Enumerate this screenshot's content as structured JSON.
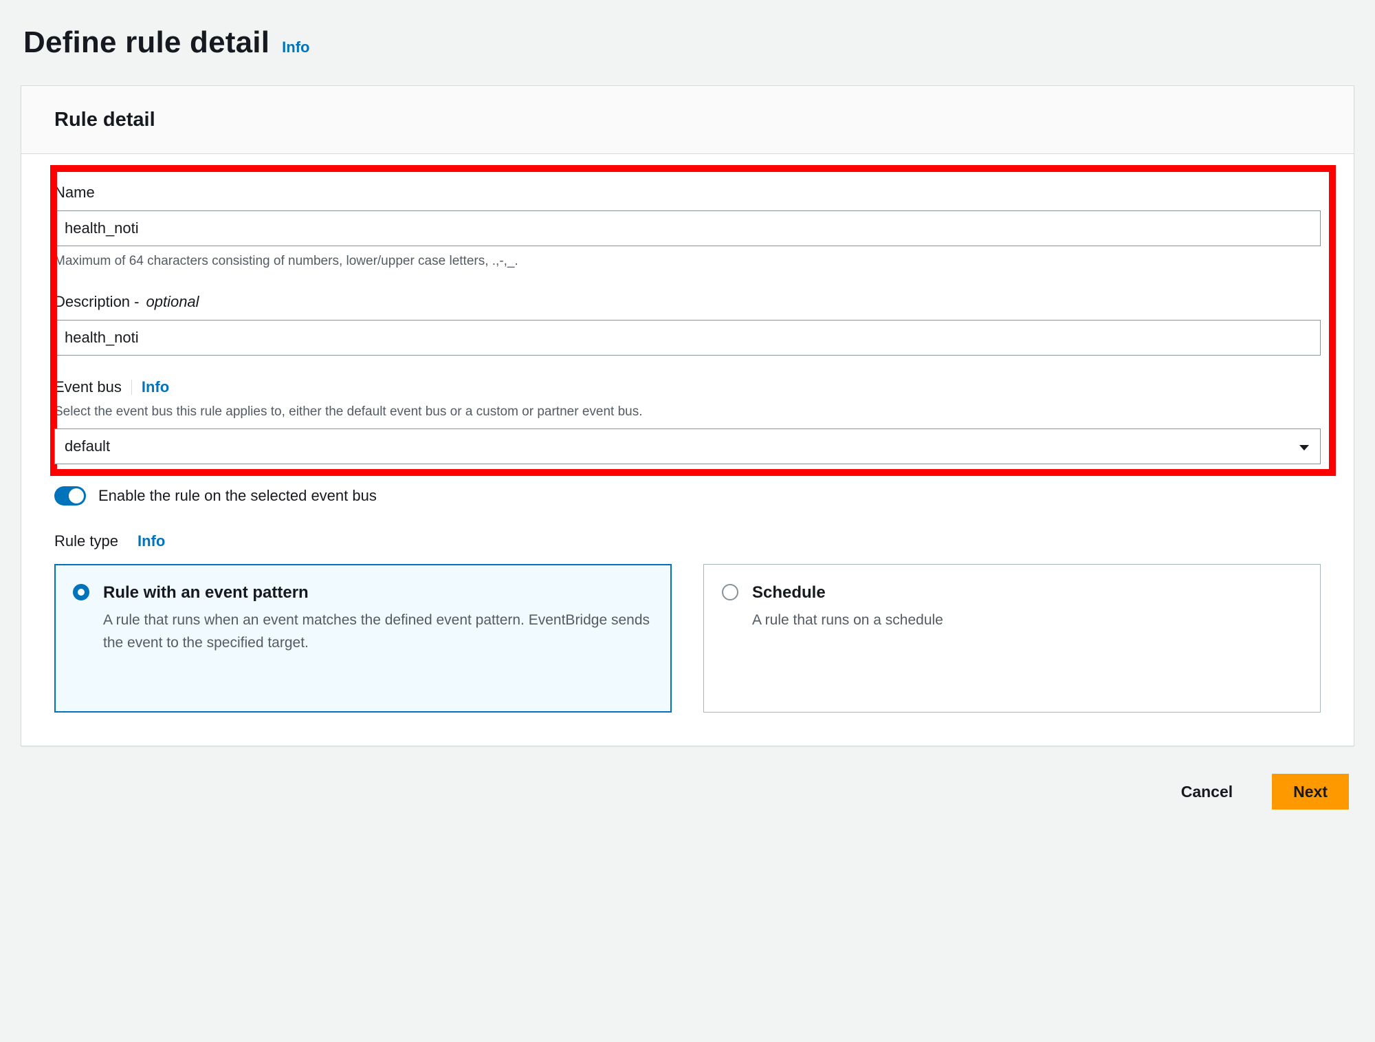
{
  "page": {
    "title": "Define rule detail",
    "info_label": "Info"
  },
  "card": {
    "header": "Rule detail"
  },
  "fields": {
    "name": {
      "label": "Name",
      "value": "health_noti",
      "hint": "Maximum of 64 characters consisting of numbers, lower/upper case letters, .,-,_."
    },
    "description": {
      "label": "Description - ",
      "optional": "optional",
      "value": "health_noti"
    },
    "event_bus": {
      "label": "Event bus",
      "info_label": "Info",
      "hint": "Select the event bus this rule applies to, either the default event bus or a custom or partner event bus.",
      "selected": "default"
    },
    "enable_toggle": {
      "on": true,
      "label": "Enable the rule on the selected event bus"
    },
    "rule_type": {
      "label": "Rule type",
      "info_label": "Info",
      "options": [
        {
          "title": "Rule with an event pattern",
          "desc": "A rule that runs when an event matches the defined event pattern. EventBridge sends the event to the specified target.",
          "selected": true
        },
        {
          "title": "Schedule",
          "desc": "A rule that runs on a schedule",
          "selected": false
        }
      ]
    }
  },
  "actions": {
    "cancel": "Cancel",
    "next": "Next"
  }
}
